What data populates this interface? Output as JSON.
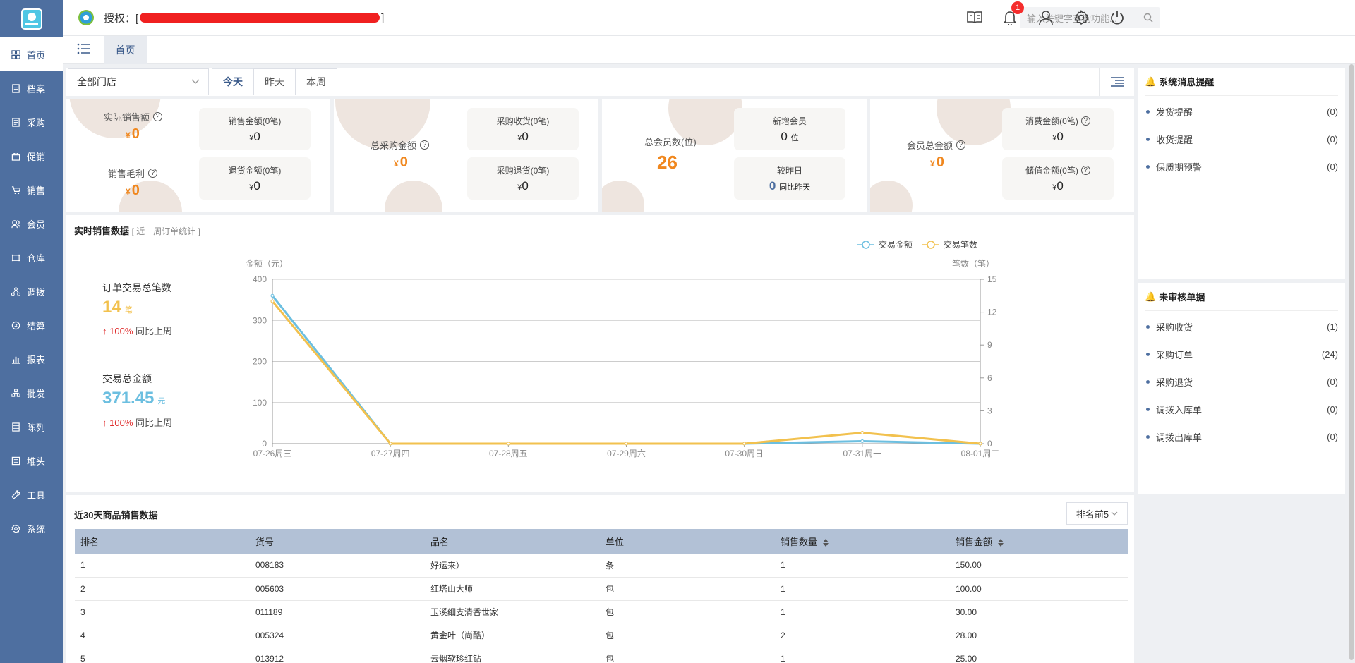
{
  "sidebar": {
    "items": [
      {
        "label": "首页",
        "icon": "dashboard-icon"
      },
      {
        "label": "档案",
        "icon": "archive-icon"
      },
      {
        "label": "采购",
        "icon": "purchase-icon"
      },
      {
        "label": "促销",
        "icon": "gift-icon"
      },
      {
        "label": "销售",
        "icon": "cart-icon"
      },
      {
        "label": "会员",
        "icon": "member-icon"
      },
      {
        "label": "仓库",
        "icon": "warehouse-icon"
      },
      {
        "label": "调拨",
        "icon": "transfer-icon"
      },
      {
        "label": "结算",
        "icon": "settlement-icon"
      },
      {
        "label": "报表",
        "icon": "report-icon"
      },
      {
        "label": "批发",
        "icon": "wholesale-icon"
      },
      {
        "label": "陈列",
        "icon": "display-icon"
      },
      {
        "label": "堆头",
        "icon": "pile-icon"
      },
      {
        "label": "工具",
        "icon": "tool-icon"
      },
      {
        "label": "系统",
        "icon": "system-icon"
      }
    ]
  },
  "header": {
    "auth_prefix": "授权：[",
    "auth_suffix": "]",
    "search_placeholder": "输入关键字查询功能...",
    "notification_count": "1"
  },
  "tabs": {
    "home": "首页"
  },
  "filter": {
    "store": "全部门店",
    "dates": [
      "今天",
      "昨天",
      "本周"
    ]
  },
  "cards": {
    "sales": {
      "actual_label": "实际销售额",
      "actual_value": "0",
      "profit_label": "销售毛利",
      "profit_value": "0",
      "sub1_label": "销售金额(0笔)",
      "sub1_value": "0",
      "sub2_label": "退货金额(0笔)",
      "sub2_value": "0"
    },
    "purchase": {
      "total_label": "总采购金额",
      "total_value": "0",
      "sub1_label": "采购收货(0笔)",
      "sub1_value": "0",
      "sub2_label": "采购退货(0笔)",
      "sub2_value": "0"
    },
    "members": {
      "total_label": "总会员数(位)",
      "total_value": "26",
      "sub1_label": "新增会员",
      "sub1_value": "0",
      "sub1_unit": "位",
      "sub2_label": "较昨日",
      "sub2_value": "0",
      "sub2_unit": "同比昨天"
    },
    "balance": {
      "total_label": "会员总金额",
      "total_value": "0",
      "sub1_label": "消费金额(0笔)",
      "sub1_value": "0",
      "sub2_label": "储值金额(0笔)",
      "sub2_value": "0"
    },
    "currency": "¥"
  },
  "realtime": {
    "title": "实时销售数据",
    "subtitle": "[ 近一周订单统计 ]",
    "orders_label": "订单交易总笔数",
    "orders_value": "14",
    "orders_unit": "笔",
    "orders_pct": "100%",
    "orders_cmp": "同比上周",
    "amount_label": "交易总金额",
    "amount_value": "371.45",
    "amount_unit": "元",
    "amount_pct": "100%",
    "amount_cmp": "同比上周"
  },
  "chart_data": {
    "type": "line",
    "categories": [
      "07-26周三",
      "07-27周四",
      "07-28周五",
      "07-29周六",
      "07-30周日",
      "07-31周一",
      "08-01周二"
    ],
    "series": [
      {
        "name": "交易金额",
        "axis": "left",
        "color": "#6cbfe0",
        "values": [
          360,
          0,
          0,
          0,
          0,
          6,
          0
        ]
      },
      {
        "name": "交易笔数",
        "axis": "right",
        "color": "#f2c14e",
        "values": [
          13,
          0,
          0,
          0,
          0,
          1,
          0
        ]
      }
    ],
    "ylabel": "金额（元）",
    "y2label": "笔数（笔）",
    "ylim": [
      0,
      400
    ],
    "yticks": [
      0,
      100,
      200,
      300,
      400
    ],
    "y2lim": [
      0,
      15
    ],
    "y2ticks": [
      0,
      3,
      6,
      9,
      12,
      15
    ],
    "legend": "top-right",
    "grid": true
  },
  "products": {
    "title": "近30天商品销售数据",
    "rank_select": "排名前5",
    "columns": [
      "排名",
      "货号",
      "品名",
      "单位",
      "销售数量",
      "销售金额"
    ],
    "rows": [
      [
        "1",
        "008183",
        "好运来）",
        "条",
        "1",
        "150.00"
      ],
      [
        "2",
        "005603",
        "红塔山大师",
        "包",
        "1",
        "100.00"
      ],
      [
        "3",
        "011189",
        "玉溪细支清香世家",
        "包",
        "1",
        "30.00"
      ],
      [
        "4",
        "005324",
        "黄金叶（尚酷）",
        "包",
        "2",
        "28.00"
      ],
      [
        "5",
        "013912",
        "云烟软珍红钻",
        "包",
        "1",
        "25.00"
      ]
    ]
  },
  "notices": {
    "title": "系统消息提醒",
    "items": [
      {
        "name": "发货提醒",
        "count": "(0)"
      },
      {
        "name": "收货提醒",
        "count": "(0)"
      },
      {
        "name": "保质期预警",
        "count": "(0)"
      }
    ]
  },
  "pending": {
    "title": "未审核单据",
    "items": [
      {
        "name": "采购收货",
        "count": "(1)"
      },
      {
        "name": "采购订单",
        "count": "(24)"
      },
      {
        "name": "采购退货",
        "count": "(0)"
      },
      {
        "name": "调拨入库单",
        "count": "(0)"
      },
      {
        "name": "调拨出库单",
        "count": "(0)"
      }
    ]
  }
}
